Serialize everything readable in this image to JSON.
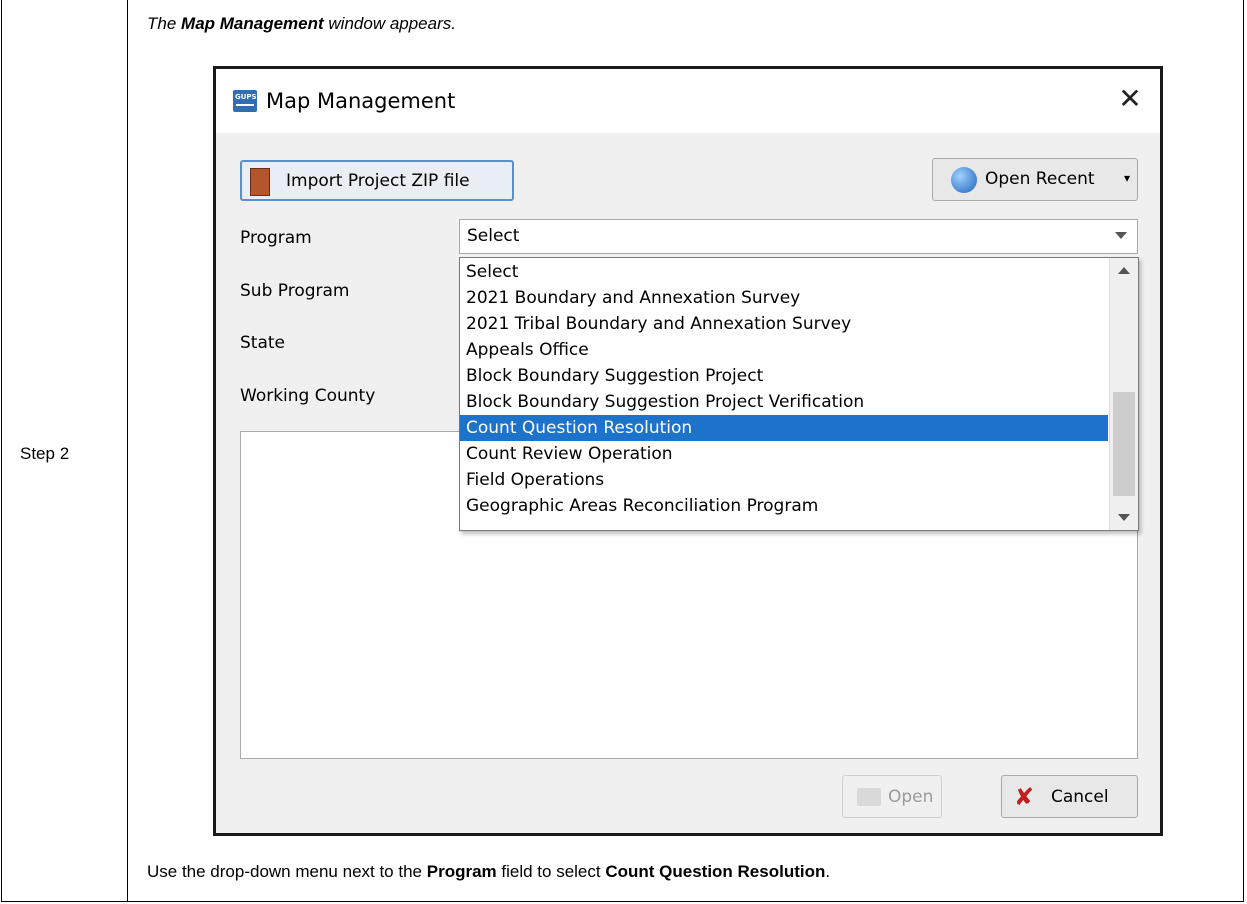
{
  "doc": {
    "step_label": "Step 2",
    "intro_prefix": "The ",
    "intro_bold": "Map Management",
    "intro_suffix": " window appears.",
    "footer_part1": "Use the drop-down menu next to the ",
    "footer_bold1": "Program",
    "footer_part2": " field to select ",
    "footer_bold2": "Count Question Resolution",
    "footer_part3": "."
  },
  "window": {
    "icon_text": "GUPS",
    "title": "Map Management",
    "close_glyph": "✕",
    "import_button": "Import Project ZIP file",
    "open_recent_button": "Open Recent",
    "open_recent_arrow": "▾",
    "labels": {
      "program": "Program",
      "sub_program": "Sub Program",
      "state": "State",
      "working_county": "Working County"
    },
    "program_value": "Select",
    "dropdown_options": [
      "Select",
      "2021 Boundary and Annexation Survey",
      "2021 Tribal Boundary and Annexation Survey",
      "Appeals Office",
      "Block Boundary Suggestion Project",
      "Block Boundary Suggestion Project Verification",
      "Count Question Resolution",
      "Count Review Operation",
      "Field Operations",
      "Geographic Areas Reconciliation Program"
    ],
    "selected_option": "Count Question Resolution",
    "open_button": "Open",
    "cancel_button": "Cancel",
    "cancel_icon": "✘"
  },
  "colors": {
    "selection": "#1c73c9",
    "window_bg": "#f0f0f0"
  }
}
